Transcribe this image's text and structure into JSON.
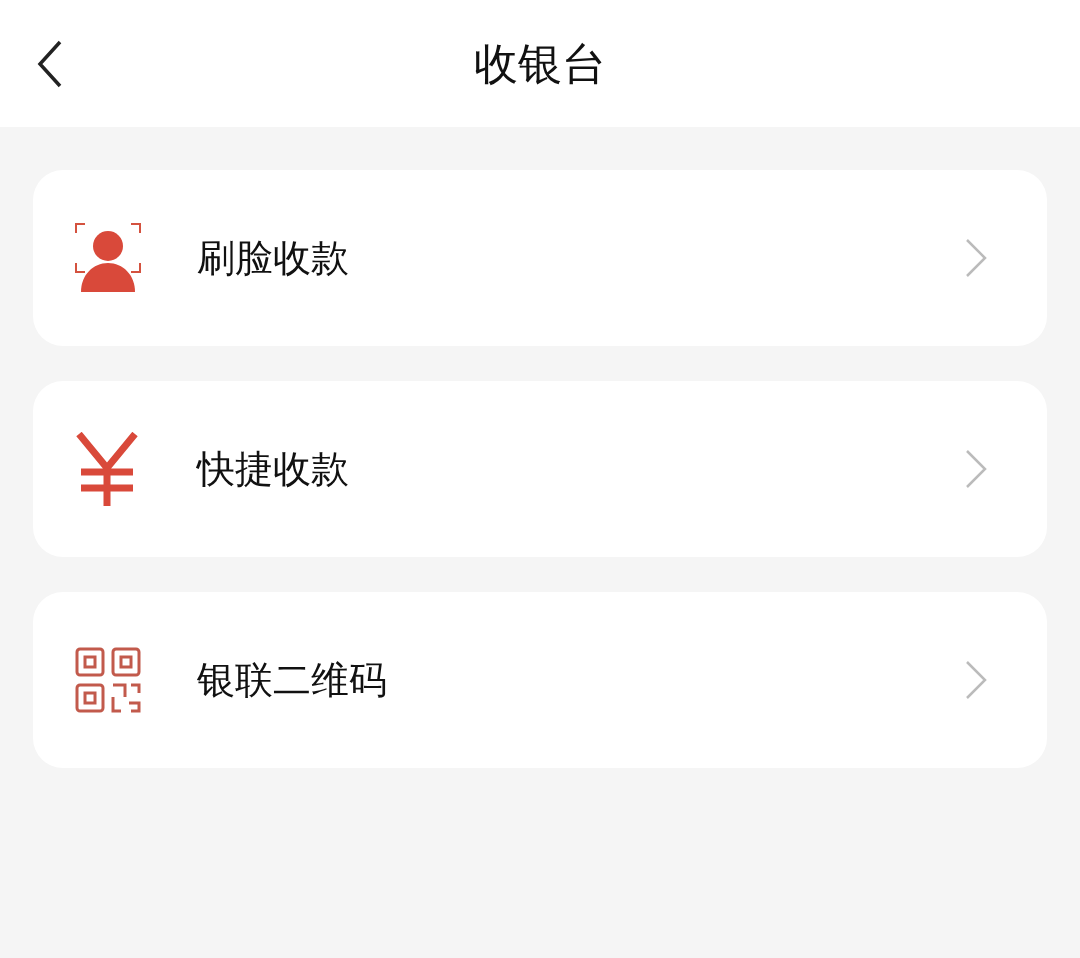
{
  "header": {
    "title": "收银台"
  },
  "items": [
    {
      "kind": "face",
      "label": "刷脸收款"
    },
    {
      "kind": "yuan",
      "label": "快捷收款"
    },
    {
      "kind": "qrcode",
      "label": "银联二维码"
    }
  ]
}
